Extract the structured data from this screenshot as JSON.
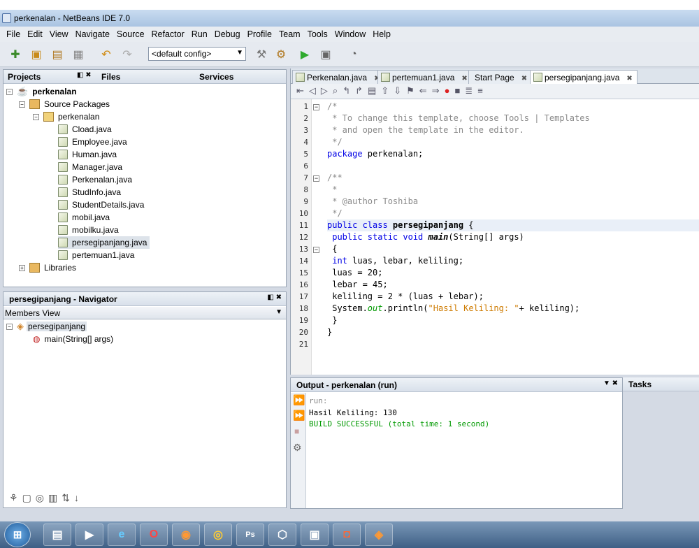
{
  "window": {
    "title": "perkenalan - NetBeans IDE 7.0"
  },
  "menu": [
    "File",
    "Edit",
    "View",
    "Navigate",
    "Source",
    "Refactor",
    "Run",
    "Debug",
    "Profile",
    "Team",
    "Tools",
    "Window",
    "Help"
  ],
  "toolbar": {
    "config": "<default config>"
  },
  "projects_panel": {
    "tabs": [
      "Projects",
      "Files",
      "Services"
    ],
    "root": "perkenalan",
    "source_packages": "Source Packages",
    "package": "perkenalan",
    "files": [
      "Cload.java",
      "Employee.java",
      "Human.java",
      "Manager.java",
      "Perkenalan.java",
      "StudInfo.java",
      "StudentDetails.java",
      "mobil.java",
      "mobilku.java",
      "persegipanjang.java",
      "pertemuan1.java"
    ],
    "selected_file": "persegipanjang.java",
    "libraries": "Libraries"
  },
  "navigator": {
    "title": "persegipanjang - Navigator",
    "view": "Members View",
    "class": "persegipanjang",
    "method": "main(String[] args)"
  },
  "editor": {
    "tabs": [
      "Perkenalan.java",
      "pertemuan1.java",
      "Start Page",
      "persegipanjang.java"
    ],
    "active_tab": "persegipanjang.java",
    "line_numbers": [
      "1",
      "2",
      "3",
      "4",
      "5",
      "6",
      "7",
      "8",
      "9",
      "10",
      "11",
      "12",
      "13",
      "14",
      "15",
      "16",
      "17",
      "18",
      "19",
      "20",
      "21"
    ],
    "lines": {
      "l1": "/*",
      "l2": " * To change this template, choose Tools | Templates",
      "l3": " * and open the template in the editor.",
      "l4": " */",
      "l5a": "package",
      "l5b": " perkenalan;",
      "l7": "/**",
      "l8": " *",
      "l9": " * @author Toshiba",
      "l10": " */",
      "l11a": "public class",
      "l11b": " persegipanjang",
      "l11c": " {",
      "l12a": " public static void",
      "l12b": " main",
      "l12c": "(String[] args)",
      "l13": " {",
      "l14a": " int",
      "l14b": " luas, lebar, keliling;",
      "l15": " luas = 20;",
      "l16": " lebar = 45;",
      "l17": " keliling = 2 * (luas + lebar);",
      "l18a": " System.",
      "l18b": "out",
      "l18c": ".println(",
      "l18d": "\"Hasil Keliling: \"",
      "l18e": "+ keliling);",
      "l19": " }",
      "l20": "}"
    }
  },
  "output": {
    "title": "Output - perkenalan (run)",
    "run": "run:",
    "result": "Hasil Keliling: 130",
    "build": "BUILD SUCCESSFUL (total time: 1 second)"
  },
  "tasks": {
    "title": "Tasks"
  },
  "taskbar": {
    "ps_label": "Ps"
  },
  "colors": {
    "keyword": "#0000e6",
    "string": "#ce7b00",
    "comment": "#8a8a8a",
    "build_success": "#009900"
  }
}
